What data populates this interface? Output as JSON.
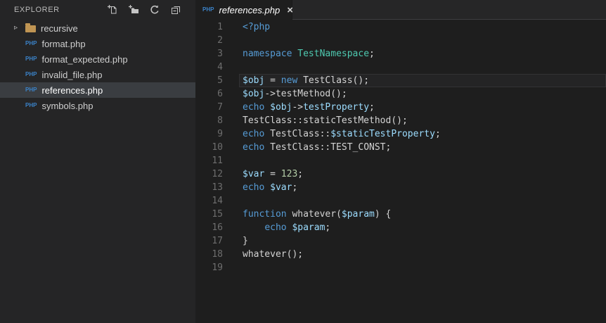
{
  "colors": {
    "kw": "#569cd6",
    "cls": "#4ec9b0",
    "var": "#9cdcfe",
    "num": "#b5cea8",
    "txt": "#d4d4d4",
    "php_badge": "#3b83c9",
    "folder": "#c09553",
    "selected_row_bg": "#3a3d41",
    "sidebar_bg": "#252526",
    "editor_bg": "#1e1e1e"
  },
  "sidebar": {
    "title": "EXPLORER",
    "actions": [
      {
        "name": "new-file"
      },
      {
        "name": "new-folder"
      },
      {
        "name": "refresh"
      },
      {
        "name": "collapse-all"
      }
    ],
    "file_icon_label": "PHP",
    "chevron_glyph": "▹",
    "files": [
      {
        "label": "recursive",
        "type": "folder",
        "selected": false
      },
      {
        "label": "format.php",
        "type": "php",
        "selected": false
      },
      {
        "label": "format_expected.php",
        "type": "php",
        "selected": false
      },
      {
        "label": "invalid_file.php",
        "type": "php",
        "selected": false
      },
      {
        "label": "references.php",
        "type": "php",
        "selected": true
      },
      {
        "label": "symbols.php",
        "type": "php",
        "selected": false
      }
    ]
  },
  "tab": {
    "label": "references.php",
    "icon_label": "PHP",
    "close_glyph": "×",
    "preview": true,
    "active": true
  },
  "editor": {
    "language": "php",
    "current_line": 5,
    "lines": [
      {
        "n": 1,
        "tokens": [
          [
            "kw",
            "<?php"
          ]
        ]
      },
      {
        "n": 2,
        "tokens": []
      },
      {
        "n": 3,
        "tokens": [
          [
            "kw",
            "namespace"
          ],
          [
            "txt",
            " "
          ],
          [
            "cls",
            "TestNamespace"
          ],
          [
            "txt",
            ";"
          ]
        ]
      },
      {
        "n": 4,
        "tokens": []
      },
      {
        "n": 5,
        "tokens": [
          [
            "var",
            "$obj"
          ],
          [
            "txt",
            " = "
          ],
          [
            "kw",
            "new"
          ],
          [
            "txt",
            " TestClass();"
          ]
        ]
      },
      {
        "n": 6,
        "tokens": [
          [
            "var",
            "$obj"
          ],
          [
            "txt",
            "->testMethod();"
          ]
        ]
      },
      {
        "n": 7,
        "tokens": [
          [
            "kw",
            "echo"
          ],
          [
            "txt",
            " "
          ],
          [
            "var",
            "$obj"
          ],
          [
            "txt",
            "->"
          ],
          [
            "var",
            "testProperty"
          ],
          [
            "txt",
            ";"
          ]
        ]
      },
      {
        "n": 8,
        "tokens": [
          [
            "txt",
            "TestClass::staticTestMethod();"
          ]
        ]
      },
      {
        "n": 9,
        "tokens": [
          [
            "kw",
            "echo"
          ],
          [
            "txt",
            " TestClass::"
          ],
          [
            "var",
            "$staticTestProperty"
          ],
          [
            "txt",
            ";"
          ]
        ]
      },
      {
        "n": 10,
        "tokens": [
          [
            "kw",
            "echo"
          ],
          [
            "txt",
            " TestClass::TEST_CONST;"
          ]
        ]
      },
      {
        "n": 11,
        "tokens": []
      },
      {
        "n": 12,
        "tokens": [
          [
            "var",
            "$var"
          ],
          [
            "txt",
            " = "
          ],
          [
            "num",
            "123"
          ],
          [
            "txt",
            ";"
          ]
        ]
      },
      {
        "n": 13,
        "tokens": [
          [
            "kw",
            "echo"
          ],
          [
            "txt",
            " "
          ],
          [
            "var",
            "$var"
          ],
          [
            "txt",
            ";"
          ]
        ]
      },
      {
        "n": 14,
        "tokens": []
      },
      {
        "n": 15,
        "tokens": [
          [
            "kw",
            "function"
          ],
          [
            "txt",
            " whatever("
          ],
          [
            "var",
            "$param"
          ],
          [
            "txt",
            ") {"
          ]
        ]
      },
      {
        "n": 16,
        "tokens": [
          [
            "txt",
            "    "
          ],
          [
            "kw",
            "echo"
          ],
          [
            "txt",
            " "
          ],
          [
            "var",
            "$param"
          ],
          [
            "txt",
            ";"
          ]
        ]
      },
      {
        "n": 17,
        "tokens": [
          [
            "txt",
            "}"
          ]
        ]
      },
      {
        "n": 18,
        "tokens": [
          [
            "txt",
            "whatever();"
          ]
        ]
      },
      {
        "n": 19,
        "tokens": []
      }
    ]
  }
}
